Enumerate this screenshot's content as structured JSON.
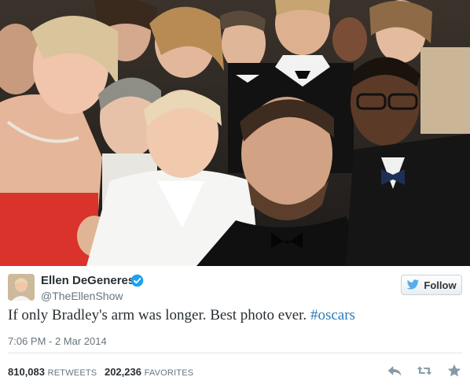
{
  "tweet": {
    "author_name": "Ellen DeGeneres",
    "author_handle": "@TheEllenShow",
    "follow_label": "Follow",
    "text_plain": "If only Bradley's arm was longer. Best photo ever. ",
    "hashtag": "#oscars",
    "timestamp": "7:06 PM - 2 Mar 2014",
    "retweets_count": "810,083",
    "retweets_label": "RETWEETS",
    "favorites_count": "202,236",
    "favorites_label": "FAVORITES"
  },
  "icons": {
    "verified": "verified-badge-icon",
    "follow": "twitter-bird-icon",
    "reply": "reply-icon",
    "retweet": "retweet-icon",
    "favorite": "star-icon"
  },
  "colors": {
    "link": "#2b7bb9",
    "verified": "#1da1f2",
    "muted": "#66757f",
    "text": "#292f33",
    "action_icon": "#8899a6"
  }
}
